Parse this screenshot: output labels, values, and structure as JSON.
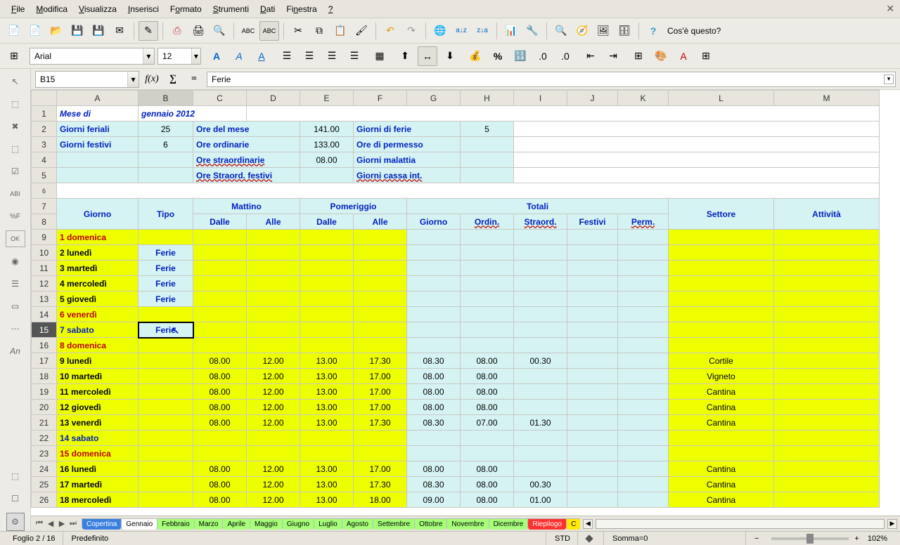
{
  "menu": [
    "File",
    "Modifica",
    "Visualizza",
    "Inserisci",
    "Formato",
    "Strumenti",
    "Dati",
    "Finestra",
    "?"
  ],
  "help_text": "Cos'è questo?",
  "font": {
    "name": "Arial",
    "size": "12"
  },
  "cell_ref": "B15",
  "formula_value": "Ferie",
  "columns": [
    "A",
    "B",
    "C",
    "D",
    "E",
    "F",
    "G",
    "H",
    "I",
    "J",
    "K",
    "L",
    "M"
  ],
  "title_left": "Mese di",
  "title_right": "gennaio 2012",
  "summary": {
    "giorni_feriali_lbl": "Giorni feriali",
    "giorni_feriali": "25",
    "ore_mese_lbl": "Ore del mese",
    "ore_mese": "141.00",
    "giorni_ferie_lbl": "Giorni di ferie",
    "giorni_ferie": "5",
    "giorni_festivi_lbl": "Giorni festivi",
    "giorni_festivi": "6",
    "ore_ord_lbl": "Ore ordinarie",
    "ore_ord": "133.00",
    "ore_perm_lbl": "Ore di permesso",
    "ore_straord_lbl": "Ore straordinarie",
    "ore_straord": "08.00",
    "giorni_mal_lbl": "Giorni malattia",
    "ore_straord_fest_lbl": "Ore Straord. festivi",
    "giorni_cassa_lbl": "Giorni cassa int."
  },
  "headers": {
    "giorno": "Giorno",
    "tipo": "Tipo",
    "mattino": "Mattino",
    "pomeriggio": "Pomeriggio",
    "totali": "Totali",
    "dalle": "Dalle",
    "alle": "Alle",
    "giorno2": "Giorno",
    "ordin": "Ordin.",
    "straord": "Straord.",
    "festivi": "Festivi",
    "perm": "Perm.",
    "settore": "Settore",
    "attivita": "Attività"
  },
  "rows": [
    {
      "n": "9",
      "day": "1 domenica",
      "cls": "red-b"
    },
    {
      "n": "10",
      "day": "2 lunedì",
      "cls": "black-b",
      "tipo": "Ferie"
    },
    {
      "n": "11",
      "day": "3 martedì",
      "cls": "black-b",
      "tipo": "Ferie"
    },
    {
      "n": "12",
      "day": "4 mercoledì",
      "cls": "black-b",
      "tipo": "Ferie"
    },
    {
      "n": "13",
      "day": "5 giovedì",
      "cls": "black-b",
      "tipo": "Ferie"
    },
    {
      "n": "14",
      "day": "6 venerdì",
      "cls": "red-b"
    },
    {
      "n": "15",
      "day": "7 sabato",
      "cls": "blue-b",
      "tipo": "Ferie",
      "active": true
    },
    {
      "n": "16",
      "day": "8 domenica",
      "cls": "red-b"
    },
    {
      "n": "17",
      "day": "9 lunedì",
      "cls": "black-b",
      "md": "08.00",
      "ma": "12.00",
      "pd": "13.00",
      "pa": "17.30",
      "tg": "08.30",
      "to": "08.00",
      "ts": "00.30",
      "set": "Cortile"
    },
    {
      "n": "18",
      "day": "10 martedì",
      "cls": "black-b",
      "md": "08.00",
      "ma": "12.00",
      "pd": "13.00",
      "pa": "17.00",
      "tg": "08.00",
      "to": "08.00",
      "set": "Vigneto"
    },
    {
      "n": "19",
      "day": "11 mercoledì",
      "cls": "black-b",
      "md": "08.00",
      "ma": "12.00",
      "pd": "13.00",
      "pa": "17.00",
      "tg": "08.00",
      "to": "08.00",
      "set": "Cantina"
    },
    {
      "n": "20",
      "day": "12 giovedì",
      "cls": "black-b",
      "md": "08.00",
      "ma": "12.00",
      "pd": "13.00",
      "pa": "17.00",
      "tg": "08.00",
      "to": "08.00",
      "set": "Cantina"
    },
    {
      "n": "21",
      "day": "13 venerdì",
      "cls": "black-b",
      "md": "08.00",
      "ma": "12.00",
      "pd": "13.00",
      "pa": "17.30",
      "tg": "08.30",
      "to": "07.00",
      "ts": "01.30",
      "set": "Cantina"
    },
    {
      "n": "22",
      "day": "14 sabato",
      "cls": "blue-b"
    },
    {
      "n": "23",
      "day": "15 domenica",
      "cls": "red-b"
    },
    {
      "n": "24",
      "day": "16 lunedì",
      "cls": "black-b",
      "md": "08.00",
      "ma": "12.00",
      "pd": "13.00",
      "pa": "17.00",
      "tg": "08.00",
      "to": "08.00",
      "set": "Cantina"
    },
    {
      "n": "25",
      "day": "17 martedì",
      "cls": "black-b",
      "md": "08.00",
      "ma": "12.00",
      "pd": "13.00",
      "pa": "17.30",
      "tg": "08.30",
      "to": "08.00",
      "ts": "00.30",
      "set": "Cantina"
    },
    {
      "n": "26",
      "day": "18 mercoledì",
      "cls": "black-b",
      "md": "08.00",
      "ma": "12.00",
      "pd": "13.00",
      "pa": "18.00",
      "tg": "09.00",
      "to": "08.00",
      "ts": "01.00",
      "set": "Cantina"
    }
  ],
  "tabs": [
    {
      "label": "Copertina",
      "cls": "blue"
    },
    {
      "label": "Gennaio",
      "cls": "white"
    },
    {
      "label": "Febbraio",
      "cls": ""
    },
    {
      "label": "Marzo",
      "cls": ""
    },
    {
      "label": "Aprile",
      "cls": ""
    },
    {
      "label": "Maggio",
      "cls": ""
    },
    {
      "label": "Giugno",
      "cls": ""
    },
    {
      "label": "Luglio",
      "cls": ""
    },
    {
      "label": "Agosto",
      "cls": ""
    },
    {
      "label": "Settembre",
      "cls": ""
    },
    {
      "label": "Ottobre",
      "cls": ""
    },
    {
      "label": "Novembre",
      "cls": ""
    },
    {
      "label": "Dicembre",
      "cls": ""
    },
    {
      "label": "Riepilogo",
      "cls": "red"
    },
    {
      "label": "C",
      "cls": "yellow2"
    }
  ],
  "status": {
    "sheet": "Foglio 2 / 16",
    "style": "Predefinito",
    "mode": "STD",
    "sum": "Somma=0",
    "zoom": "102%"
  }
}
